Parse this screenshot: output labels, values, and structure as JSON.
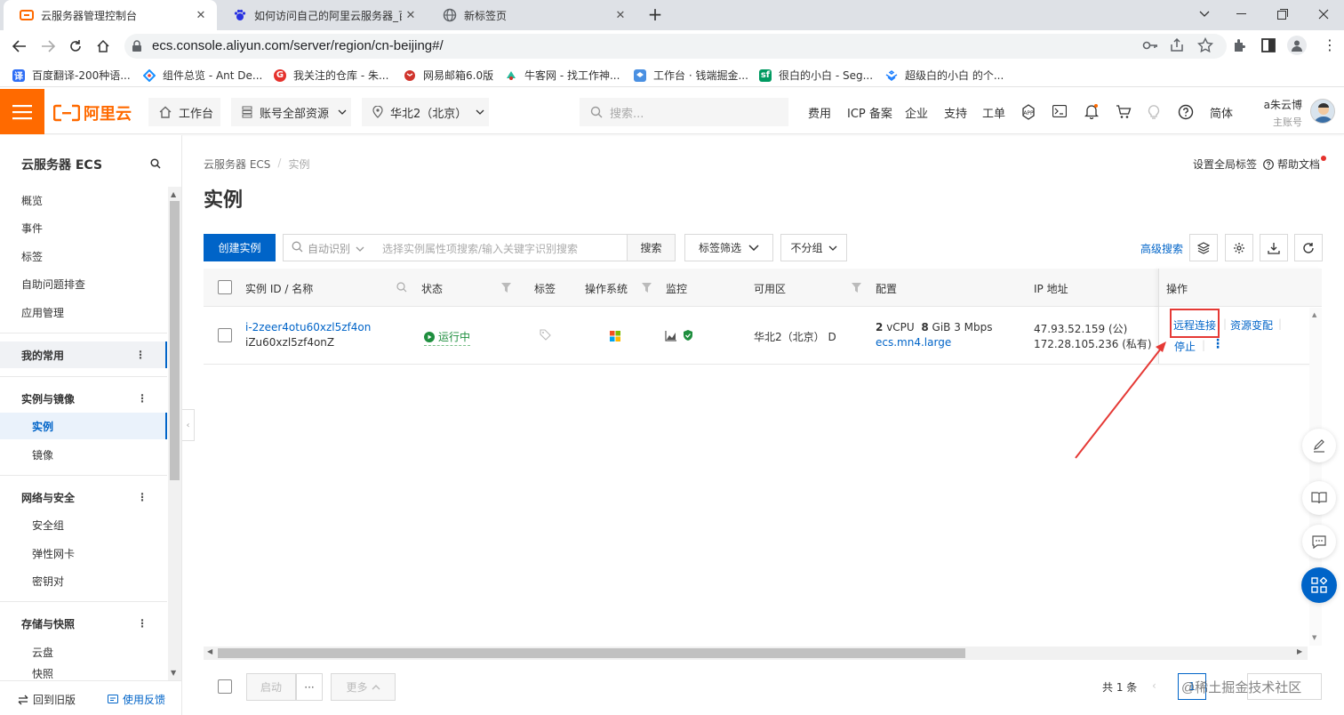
{
  "browser": {
    "tabs": [
      {
        "title": "云服务器管理控制台",
        "icon": "aliyun-icon"
      },
      {
        "title": "如何访问自己的阿里云服务器_百",
        "icon": "baidu-paw-icon"
      },
      {
        "title": "新标签页",
        "icon": "globe-icon"
      }
    ],
    "url": "ecs.console.aliyun.com/server/region/cn-beijing#/",
    "bookmarks": [
      {
        "label": "百度翻译-200种语...",
        "icon_text": "译",
        "color": "#2e6ef5"
      },
      {
        "label": "组件总览 - Ant De...",
        "icon_text": "",
        "color": "#f04134"
      },
      {
        "label": "我关注的仓库 - 朱...",
        "icon_text": "G",
        "color": "#e5322d"
      },
      {
        "label": "网易邮箱6.0版",
        "icon_text": "",
        "color": "#d0342c"
      },
      {
        "label": "牛客网 - 找工作神...",
        "icon_text": "",
        "color": "#25bb9b"
      },
      {
        "label": "工作台 · 钱端掘金...",
        "icon_text": "",
        "color": "#4a90e2"
      },
      {
        "label": "很白的小白 - Seg...",
        "icon_text": "sf",
        "color": "#009a61"
      },
      {
        "label": "超级白的小白 的个...",
        "icon_text": "",
        "color": "#1e80ff"
      }
    ]
  },
  "header": {
    "logo": "阿里云",
    "workbench": "工作台",
    "account_resources": "账号全部资源",
    "region": "华北2（北京）",
    "search_placeholder": "搜索...",
    "links": [
      "费用",
      "ICP 备案",
      "企业",
      "支持",
      "工单"
    ],
    "lang": "简体",
    "user_name": "a朱云博",
    "user_role": "主账号"
  },
  "sidebar": {
    "title": "云服务器 ECS",
    "items": [
      "概览",
      "事件",
      "标签",
      "自助问题排查",
      "应用管理"
    ],
    "favorites": "我的常用",
    "group_instances": "实例与镜像",
    "instances": "实例",
    "images": "镜像",
    "group_network": "网络与安全",
    "security_group": "安全组",
    "eni": "弹性网卡",
    "keypair": "密钥对",
    "group_storage": "存储与快照",
    "disk": "云盘",
    "snapshot": "快照",
    "back_old": "回到旧版",
    "feedback": "使用反馈"
  },
  "main": {
    "breadcrumb": [
      "云服务器 ECS",
      "实例"
    ],
    "page_title": "实例",
    "global_tag": "设置全局标签",
    "help_doc": "帮助文档",
    "create_button": "创建实例",
    "search_mode": "自动识别",
    "search_placeholder": "选择实例属性项搜索/输入关键字识别搜索",
    "search_button": "搜索",
    "tag_filter": "标签筛选",
    "group_select": "不分组",
    "advanced_search": "高级搜索",
    "columns": [
      "实例 ID / 名称",
      "状态",
      "标签",
      "操作系统",
      "监控",
      "可用区",
      "配置",
      "IP 地址",
      "操作"
    ],
    "row": {
      "instance_id": "i-2zeer4otu60xzl5zf4on",
      "instance_name": "iZu60xzl5zf4onZ",
      "status": "运行中",
      "zone": "华北2（北京） D",
      "config_cpu": "2",
      "config_cpu_unit": "vCPU",
      "config_mem": "8",
      "config_mem_unit": "GiB 3 Mbps",
      "config_type": "ecs.mn4.large",
      "ip_public": "47.93.52.159 (公)",
      "ip_private": "172.28.105.236 (私有)",
      "action_remote": "远程连接",
      "action_change": "资源变配",
      "action_stop": "停止"
    },
    "footer": {
      "start": "启动",
      "more_dots": "···",
      "more": "更多",
      "total": "共 1 条",
      "page": "1",
      "watermark": "@稀土掘金技术社区"
    }
  },
  "colors": {
    "brand_orange": "#ff6a00",
    "primary_blue": "#0064c8",
    "running_green": "#1e8e3e",
    "annotation_red": "#e53935"
  }
}
